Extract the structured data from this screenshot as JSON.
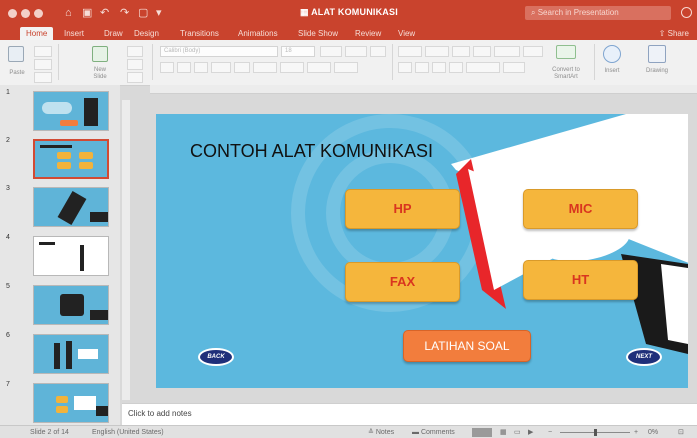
{
  "window": {
    "title": "ALAT KOMUNIKASI",
    "search_placeholder": "Search in Presentation",
    "share_label": "Share"
  },
  "tabs": [
    "Home",
    "Insert",
    "Draw",
    "Design",
    "Transitions",
    "Animations",
    "Slide Show",
    "Review",
    "View"
  ],
  "ribbon": {
    "paste": "Paste",
    "new_slide": "New Slide",
    "font_name": "Calibri (Body)",
    "font_size": "18",
    "convert": "Convert to SmartArt",
    "insert": "Insert",
    "drawing": "Drawing"
  },
  "thumbnails": [
    {
      "number": "1"
    },
    {
      "number": "2"
    },
    {
      "number": "3"
    },
    {
      "number": "4"
    },
    {
      "number": "5"
    },
    {
      "number": "6"
    },
    {
      "number": "7"
    }
  ],
  "slide": {
    "title": "CONTOH ALAT KOMUNIKASI",
    "options": [
      "HP",
      "MIC",
      "FAX",
      "HT"
    ],
    "quiz_button": "LATIHAN SOAL",
    "back_button": "BACK",
    "next_button": "NEXT"
  },
  "notes_placeholder": "Click to add notes",
  "status": {
    "slide_position": "Slide 2 of 14",
    "language": "English (United States)",
    "notes": "Notes",
    "comments": "Comments",
    "zoom": "0%"
  },
  "colors": {
    "accent": "#c9432d",
    "slide_background": "#5cb8de",
    "option_fill": "#f5b63c",
    "option_text": "#d9351f",
    "quiz_fill": "#f27d3d",
    "nav_fill": "#1f2f7a"
  }
}
